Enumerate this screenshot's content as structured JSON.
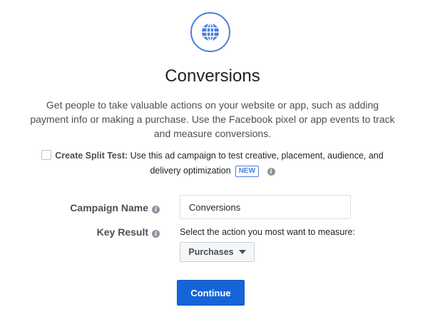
{
  "hero": {
    "icon": "globe-icon",
    "title": "Conversions",
    "description": "Get people to take valuable actions on your website or app, such as adding payment info or making a purchase. Use the Facebook pixel or app events to track and measure conversions."
  },
  "split_test": {
    "checked": false,
    "label": "Create Split Test:",
    "text": "Use this ad campaign to test creative, placement, audience, and delivery optimization",
    "badge": "NEW",
    "info_icon": "info-icon"
  },
  "campaign_name": {
    "label": "Campaign Name",
    "value": "Conversions",
    "info_icon": "info-icon"
  },
  "key_result": {
    "label": "Key Result",
    "description": "Select the action you most want to measure:",
    "selected": "Purchases",
    "info_icon": "info-icon"
  },
  "actions": {
    "continue_label": "Continue"
  },
  "colors": {
    "accent": "#4a7fe0",
    "primary_button": "#1565d8",
    "text": "#1d2129",
    "muted_text": "#4b4f56"
  }
}
